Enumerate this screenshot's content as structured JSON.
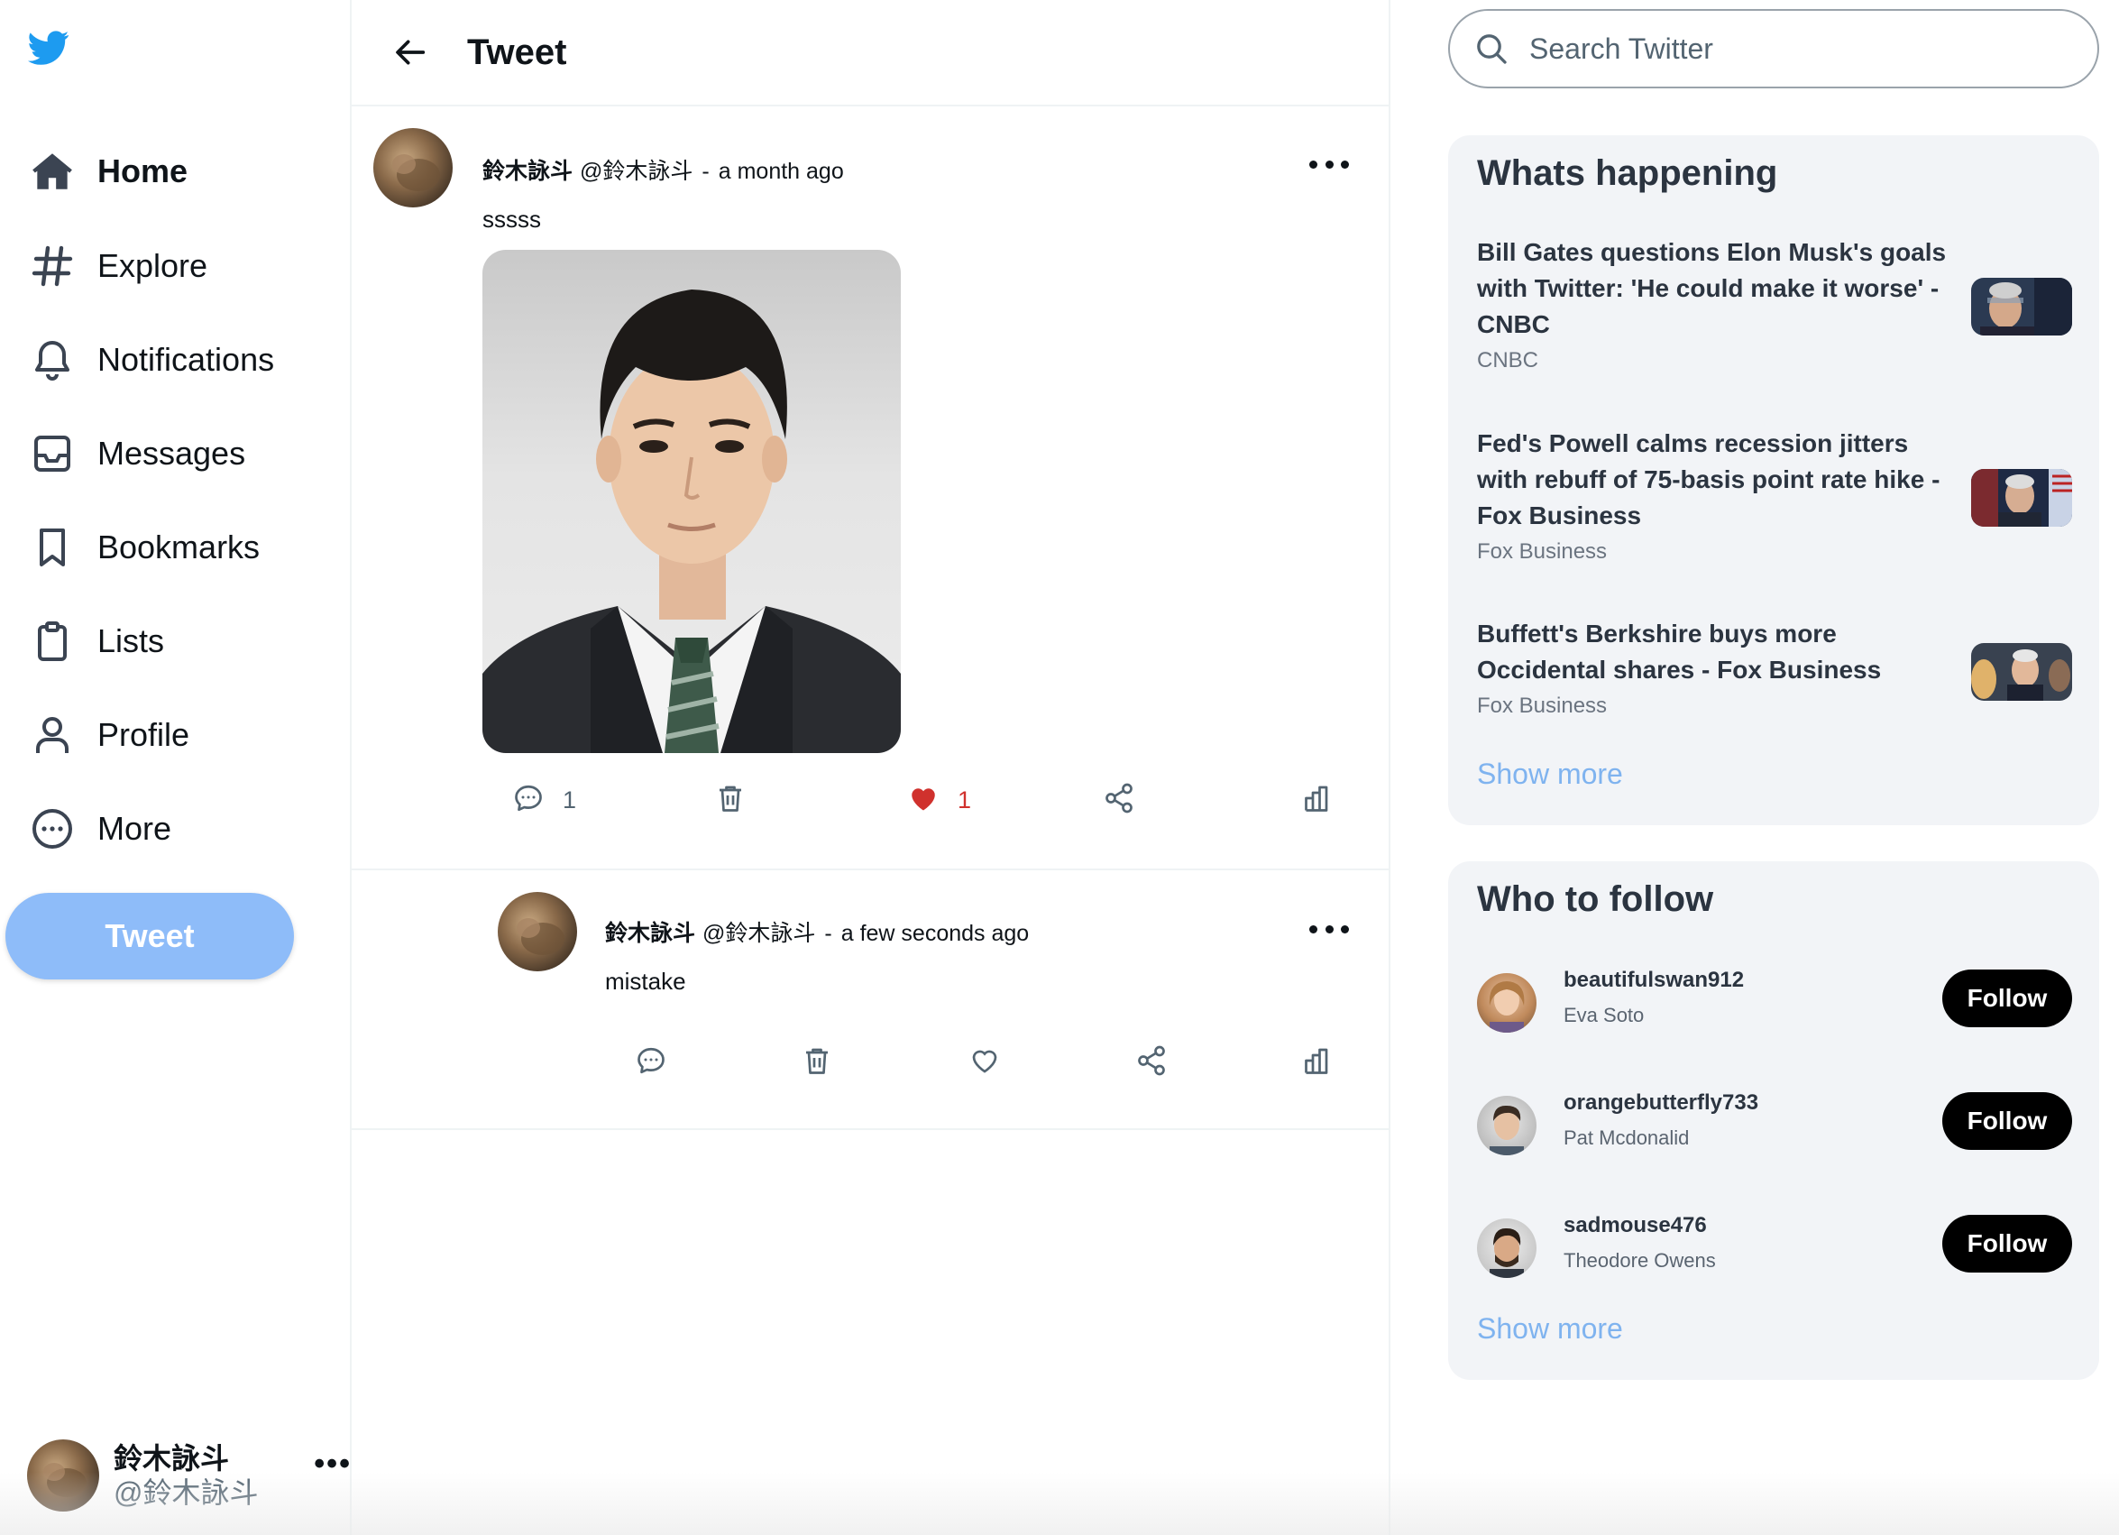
{
  "colors": {
    "brand": "#1d9bf0",
    "tweet_button": "#8ebcf9",
    "like": "#d0312d",
    "show_more": "#7fb3ef"
  },
  "logo": {
    "icon": "twitter-bird-icon"
  },
  "nav": [
    {
      "label": "Home",
      "icon": "home-icon",
      "active": true
    },
    {
      "label": "Explore",
      "icon": "hashtag-icon"
    },
    {
      "label": "Notifications",
      "icon": "bell-icon"
    },
    {
      "label": "Messages",
      "icon": "inbox-icon"
    },
    {
      "label": "Bookmarks",
      "icon": "bookmark-icon"
    },
    {
      "label": "Lists",
      "icon": "clipboard-icon"
    },
    {
      "label": "Profile",
      "icon": "person-icon"
    },
    {
      "label": "More",
      "icon": "more-circle-icon"
    }
  ],
  "tweet_button": "Tweet",
  "account": {
    "name": "鈴木詠斗",
    "handle": "@鈴木詠斗",
    "more": "•••"
  },
  "header": {
    "title": "Tweet"
  },
  "main_tweet": {
    "name": "鈴木詠斗",
    "handle": "@鈴木詠斗",
    "separator": "-",
    "time": "a month ago",
    "text": "sssss",
    "reply_count": "1",
    "like_count": "1",
    "liked": true
  },
  "reply": {
    "name": "鈴木詠斗",
    "handle": "@鈴木詠斗",
    "separator": "-",
    "time": "a few seconds ago",
    "text": "mistake"
  },
  "search": {
    "placeholder": "Search Twitter"
  },
  "whats_happening": {
    "title": "Whats happening",
    "trends": [
      {
        "title": "Bill Gates questions Elon Musk's goals with Twitter: 'He could make it worse' - CNBC",
        "source": "CNBC"
      },
      {
        "title": "Fed's Powell calms recession jitters with rebuff of 75-basis point rate hike - Fox Business",
        "source": "Fox Business"
      },
      {
        "title": "Buffett's Berkshire buys more Occidental shares - Fox Business",
        "source": "Fox Business"
      }
    ],
    "show_more": "Show more"
  },
  "who_to_follow": {
    "title": "Who to follow",
    "users": [
      {
        "username": "beautifulswan912",
        "name": "Eva Soto",
        "button": "Follow"
      },
      {
        "username": "orangebutterfly733",
        "name": "Pat Mcdonalid",
        "button": "Follow"
      },
      {
        "username": "sadmouse476",
        "name": "Theodore Owens",
        "button": "Follow"
      }
    ],
    "show_more": "Show more"
  }
}
